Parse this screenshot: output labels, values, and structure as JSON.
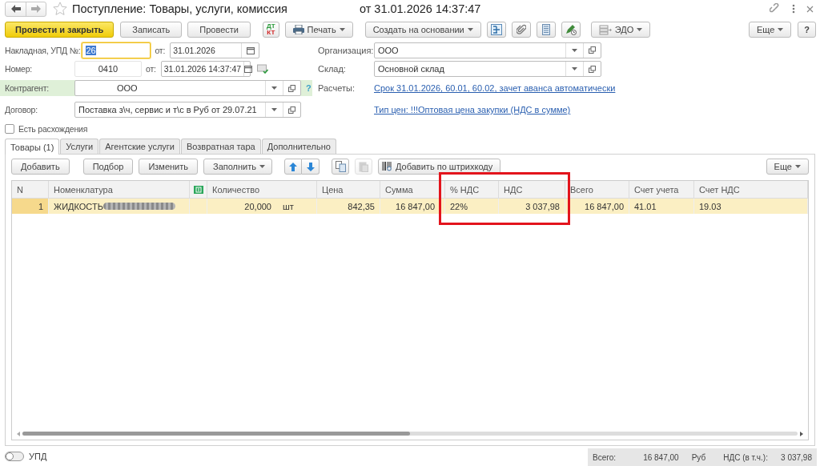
{
  "window": {
    "title": "Поступление: Товары, услуги, комиссия",
    "date": "от 31.01.2026 14:37:47"
  },
  "toolbar": [
    {
      "kind": "primary",
      "label": "Провести и закрыть"
    },
    {
      "kind": "button",
      "label": "Записать"
    },
    {
      "kind": "button",
      "label": "Провести"
    },
    {
      "kind": "dtkt",
      "top": "ДТ",
      "bottom": "КТ"
    },
    {
      "kind": "menu",
      "label": "Печать"
    },
    {
      "kind": "menu",
      "label": "Создать на основании"
    },
    {
      "kind": "icon"
    },
    {
      "kind": "icon"
    },
    {
      "kind": "icon"
    },
    {
      "kind": "icon"
    },
    {
      "kind": "menu",
      "label": "ЭДО"
    }
  ],
  "toolbar_right": [
    {
      "kind": "menu",
      "label": "Еще"
    },
    {
      "kind": "button",
      "label": "?"
    }
  ],
  "fields": {
    "invoice": {
      "label": "Накладная, УПД №:",
      "value": "26",
      "focused": true,
      "text_selected": true,
      "date_label": "от:",
      "date": "31.01.2026"
    },
    "number": {
      "label": "Номер:",
      "value": "0410",
      "date_label": "от:",
      "date": "31.01.2026 14:37:47"
    },
    "organization": {
      "label": "Организация:",
      "value": "ООО"
    },
    "warehouse": {
      "label": "Склад:",
      "value": "Основной склад"
    },
    "counterparty": {
      "label": "Контрагент:",
      "value": "ООО",
      "help": "?"
    },
    "settlements": {
      "label": "Расчеты:",
      "link": "Срок 31.01.2026, 60.01, 60.02, зачет аванса автоматически"
    },
    "contract": {
      "label": "Договор:",
      "value": "Поставка з\\ч, сервис и т\\с в Руб от 29.07.21"
    },
    "price_type": {
      "link": "Тип цен: !!!Оптовая цена закупки (НДС в сумме)"
    },
    "discrepancies": {
      "label": "Есть расхождения",
      "checked": false
    }
  },
  "tabs": [
    {
      "label": "Товары (1)",
      "selected": true
    },
    {
      "label": "Услуги",
      "selected": false
    },
    {
      "label": "Агентские услуги",
      "selected": false
    },
    {
      "label": "Возвратная тара",
      "selected": false
    },
    {
      "label": "Дополнительно",
      "selected": false
    }
  ],
  "table_toolbar": [
    {
      "kind": "button",
      "label": "Добавить",
      "disabled": false
    },
    {
      "kind": "button",
      "label": "Подбор",
      "disabled": false
    },
    {
      "kind": "button",
      "label": "Изменить",
      "disabled": false
    },
    {
      "kind": "menu",
      "label": "Заполнить",
      "disabled": false
    },
    {
      "kind": "up",
      "disabled": false
    },
    {
      "kind": "down",
      "disabled": false
    },
    {
      "kind": "copy",
      "disabled": false
    },
    {
      "kind": "paste",
      "disabled": true
    },
    {
      "kind": "barcode",
      "label": "Добавить по штрихкоду",
      "disabled": false
    }
  ],
  "table_more": {
    "label": "Еще"
  },
  "table": {
    "columns": [
      {
        "title": "N",
        "highlighted": false
      },
      {
        "title": "Номенклатура",
        "highlighted": false
      },
      {
        "kind": "icon",
        "highlighted": false
      },
      {
        "title": "Количество",
        "kind": "quantity",
        "highlighted": false
      },
      {
        "title": "Цена",
        "highlighted": false
      },
      {
        "title": "Сумма",
        "highlighted": false
      },
      {
        "title": "% НДС",
        "highlighted": true
      },
      {
        "title": "НДС",
        "highlighted": true
      },
      {
        "title": "Всего",
        "highlighted": false
      },
      {
        "title": "Счет учета",
        "highlighted": false
      },
      {
        "title": "Счет НДС",
        "highlighted": false
      }
    ],
    "rows": [
      {
        "selected": true,
        "redacted": true,
        "unit": "шт",
        "cells": [
          "1",
          "ЖИДКОСТЬ",
          "",
          "20,000",
          "842,35",
          "16 847,00",
          "22%",
          "3 037,98",
          "16 847,00",
          "41.01",
          "19.03"
        ]
      }
    ]
  },
  "footer": {
    "toggle": {
      "label": "УПД",
      "on": false
    },
    "totals": [
      {
        "label": "Всего:",
        "value": "16 847,00",
        "currency": "Руб"
      },
      {
        "label": "НДС (в т.ч.):",
        "value": "3 037,98"
      }
    ]
  }
}
